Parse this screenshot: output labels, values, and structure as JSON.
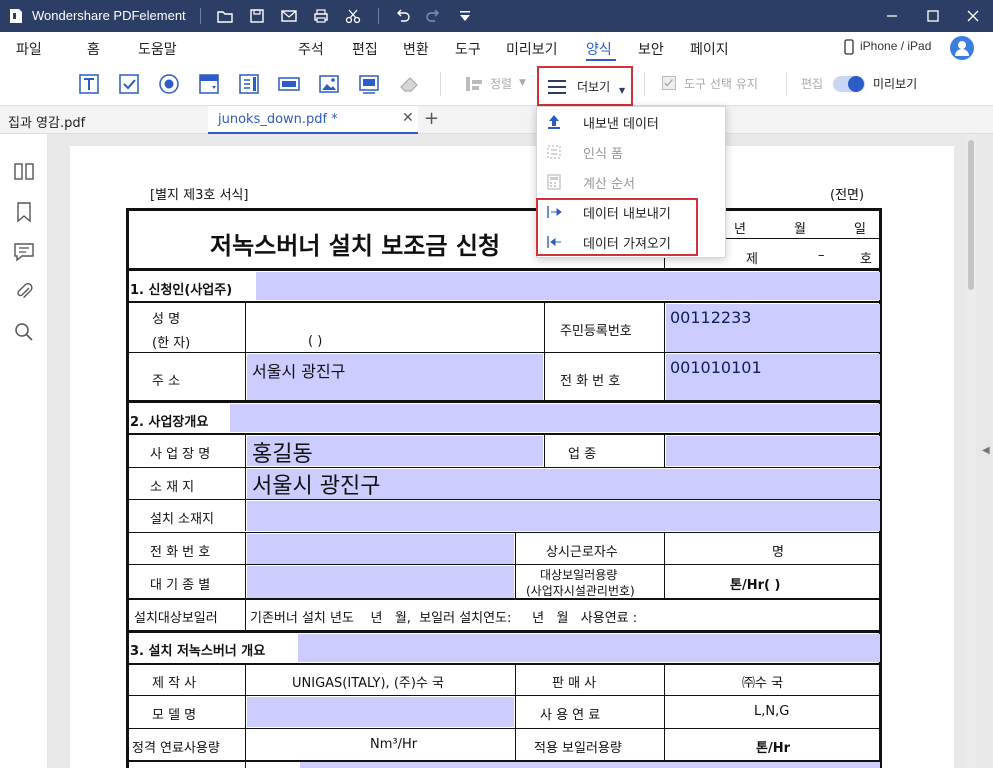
{
  "app": {
    "title": "Wondershare PDFelement"
  },
  "menus": [
    "파일",
    "홈",
    "도움말",
    "주석",
    "편집",
    "변환",
    "도구",
    "미리보기",
    "양식",
    "보안",
    "페이지"
  ],
  "active_menu": "양식",
  "device": {
    "label": "iPhone / iPad"
  },
  "toolbar": {
    "align_label": "정렬",
    "more_label": "더보기",
    "keep_tool_label": "도구 선택 유지",
    "edit_label": "편집",
    "preview_label": "미리보기"
  },
  "tabs": [
    {
      "label": "집과 영감.pdf",
      "active": false
    },
    {
      "label": "junoks_down.pdf *",
      "active": true
    }
  ],
  "dropdown": {
    "items": [
      {
        "label": "내보낸 데이터",
        "enabled": true,
        "icon": "upload-icon"
      },
      {
        "label": "인식 폼",
        "enabled": false,
        "icon": "form-recognition-icon"
      },
      {
        "label": "계산 순서",
        "enabled": false,
        "icon": "calculator-icon"
      },
      {
        "label": "데이터 내보내기",
        "enabled": true,
        "icon": "export-arrow-icon"
      },
      {
        "label": "데이터 가져오기",
        "enabled": true,
        "icon": "import-arrow-icon"
      }
    ]
  },
  "form": {
    "header_left": "[별지 제3호 서식]",
    "header_right": "(전면)",
    "title": "저녹스버너 설치 보조금 신청",
    "date_year": "년",
    "date_month": "월",
    "date_day": "일",
    "number_prefix": "제",
    "number_dash": "–",
    "number_suffix": "호",
    "section1": "1. 신청인(사업주)",
    "name_label1": "성 명",
    "name_label2": "(한 자)",
    "name_paren": "( )",
    "resident_label": "주민등록번호",
    "resident_value": "00112233",
    "address_label": "주 소",
    "address_value": "서울시 광진구",
    "phone_label": "전 화 번 호",
    "phone_value": "001010101",
    "section2": "2. 사업장개요",
    "workplace_label": "사 업 장 명",
    "workplace_value": "홍길동",
    "industry_label": "업 종",
    "location_label": "소 재 지",
    "location_value": "서울시 광진구",
    "install_location_label": "설치 소재지",
    "phone2_label": "전 화 번 호",
    "workers_label": "상시근로자수",
    "workers_unit": "명",
    "emission_label": "대 기 종 별",
    "boiler_capacity_label1": "대상보일러용량",
    "boiler_capacity_label2": "(사업자시설관리번호)",
    "boiler_capacity_unit": "톤/Hr( )",
    "install_boiler_label": "설치대상보일러",
    "install_boiler_text": "기존버너 설치 년도    년   월,  보일러 설치연도:     년   월   사용연료 :",
    "section3": "3. 설치 저녹스버너 개요",
    "maker_label": "제 작 사",
    "maker_value": "UNIGAS(ITALY), (주)수 국",
    "seller_label": "판 매 사",
    "seller_value": "㈜수 국",
    "model_label": "모 델 명",
    "fuel_label": "사 용 연 료",
    "fuel_value": "L,N,G",
    "rated_label": "정격 연료사용량",
    "rated_unit": "Nm³/Hr",
    "applied_label": "적용 보일러용량",
    "applied_unit": "톤/Hr"
  }
}
